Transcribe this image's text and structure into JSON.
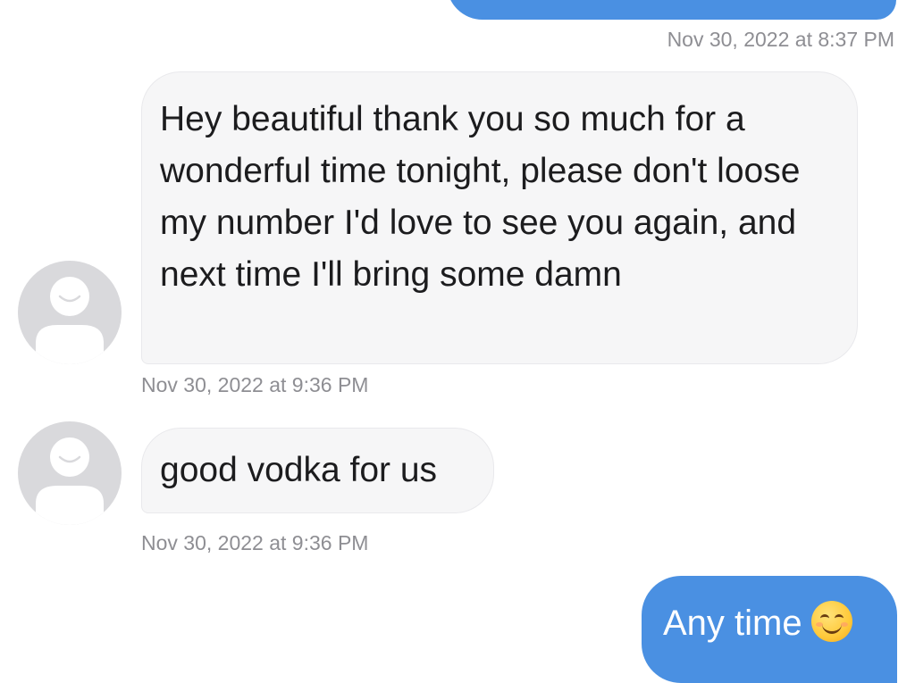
{
  "conversation": {
    "top_bubble": {
      "direction": "outgoing",
      "text": ""
    },
    "timestamps": {
      "t0": "Nov 30, 2022 at 8:37 PM",
      "t1": "Nov 30, 2022 at 9:36 PM",
      "t2": "Nov 30, 2022 at 9:36 PM"
    },
    "messages": [
      {
        "direction": "incoming",
        "text": "Hey beautiful thank you so much for a wonderful time tonight, please don't loose my number I'd love to see you again, and next time I'll bring some damn"
      },
      {
        "direction": "incoming",
        "text": "good vodka for us"
      },
      {
        "direction": "outgoing",
        "text": "Any time",
        "emoji": "smiling-face-icon"
      }
    ]
  },
  "colors": {
    "outgoing_bubble": "#4a90e2",
    "incoming_bubble": "#f6f6f7",
    "timestamp_text": "#8e8e93",
    "avatar": "#d9d9dc"
  },
  "icons": {
    "avatar": "default-avatar-icon",
    "emoji": "smiling-face-icon"
  }
}
